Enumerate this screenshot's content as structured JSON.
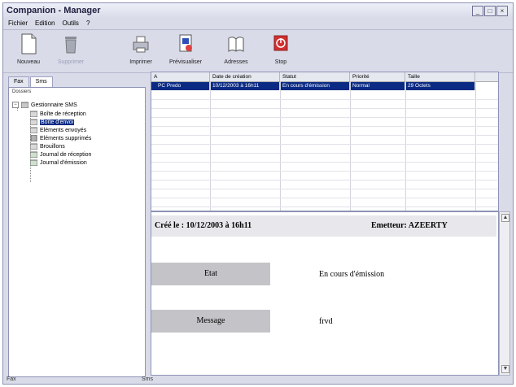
{
  "window": {
    "title": "Companion - Manager"
  },
  "menu": [
    "Fichier",
    "Edition",
    "Outils",
    "?"
  ],
  "toolbar": {
    "nouveau": "Nouveau",
    "supprimer": "Supprimer",
    "imprimer": "Imprimer",
    "previsualiser": "Prévisualiser",
    "adresses": "Adresses",
    "stop": "Stop"
  },
  "tabs": [
    "Fax",
    "Sms"
  ],
  "tree": {
    "header": "Dossiers",
    "root": "Gestionnaire SMS",
    "items": [
      "Boîte de réception",
      "Boîte d'envoi",
      "Eléments envoyés",
      "Eléments supprimés",
      "Brouillons",
      "Journal de réception",
      "Journal d'émission"
    ],
    "selected_index": 1
  },
  "grid": {
    "columns": [
      "A",
      "Date de création",
      "Statut",
      "Priorité",
      "Taille"
    ],
    "rows": [
      [
        "PC Predo",
        "10/12/2003 à 16h11",
        "En cours d'émission",
        "Normal",
        "29 Octets"
      ]
    ]
  },
  "detail": {
    "created": "Créé le : 10/12/2003 à 16h11",
    "sender": "Emetteur: AZEERTY",
    "state_label": "Etat",
    "state_value": "En cours d'émission",
    "message_label": "Message",
    "message_value": "frvd"
  },
  "statusbar": {
    "left": "Fax",
    "mid": "Sms"
  },
  "colors": {
    "selection": "#0a2a84",
    "stop": "#d03030"
  }
}
